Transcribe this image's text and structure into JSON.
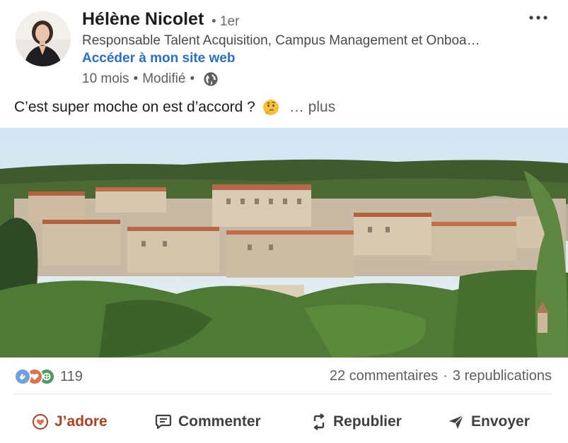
{
  "author": {
    "name": "Hélène Nicolet",
    "degree": "• 1er",
    "headline": "Responsable Talent Acquisition, Campus Management et Onboa…",
    "link_label": "Accéder à mon site web"
  },
  "meta": {
    "time": "10 mois",
    "edited": "Modifié",
    "sep": "•",
    "visibility_icon": "globe-icon"
  },
  "post": {
    "text": "C’est super moche on est d’accord ?",
    "emoji": "thinking-face",
    "see_more": "… plus"
  },
  "social": {
    "reaction_icons": [
      "clap-icon",
      "heart-icon",
      "support-icon"
    ],
    "reaction_count": "119",
    "comments": "22 commentaires",
    "reposts": "3 republications",
    "sep": "·"
  },
  "actions": {
    "like": "J’adore",
    "comment": "Commenter",
    "repost": "Republier",
    "send": "Envoyer"
  },
  "colors": {
    "link": "#2a6fc9",
    "liked": "#b24020",
    "muted": "#5e5e5e"
  }
}
